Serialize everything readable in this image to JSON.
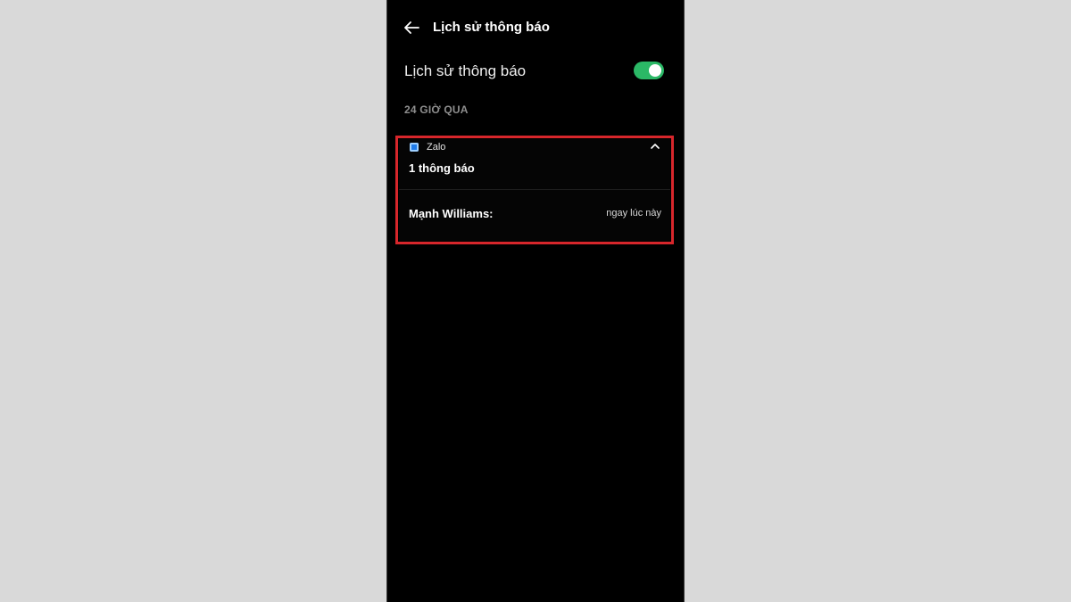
{
  "header": {
    "back_icon": "arrow-left-icon",
    "title": "Lịch sử thông báo"
  },
  "setting": {
    "label": "Lịch sử thông báo",
    "enabled": true,
    "toggle_color": "#2bb866"
  },
  "section": {
    "title": "24 GIỜ QUA"
  },
  "notification_group": {
    "app_icon": "zalo-app-icon",
    "app_name": "Zalo",
    "count_text": "1 thông báo",
    "expand_icon": "chevron-up-icon",
    "highlight_color": "#d7262b",
    "messages": [
      {
        "sender": "Mạnh Williams:",
        "time": "ngay lúc này"
      }
    ]
  }
}
